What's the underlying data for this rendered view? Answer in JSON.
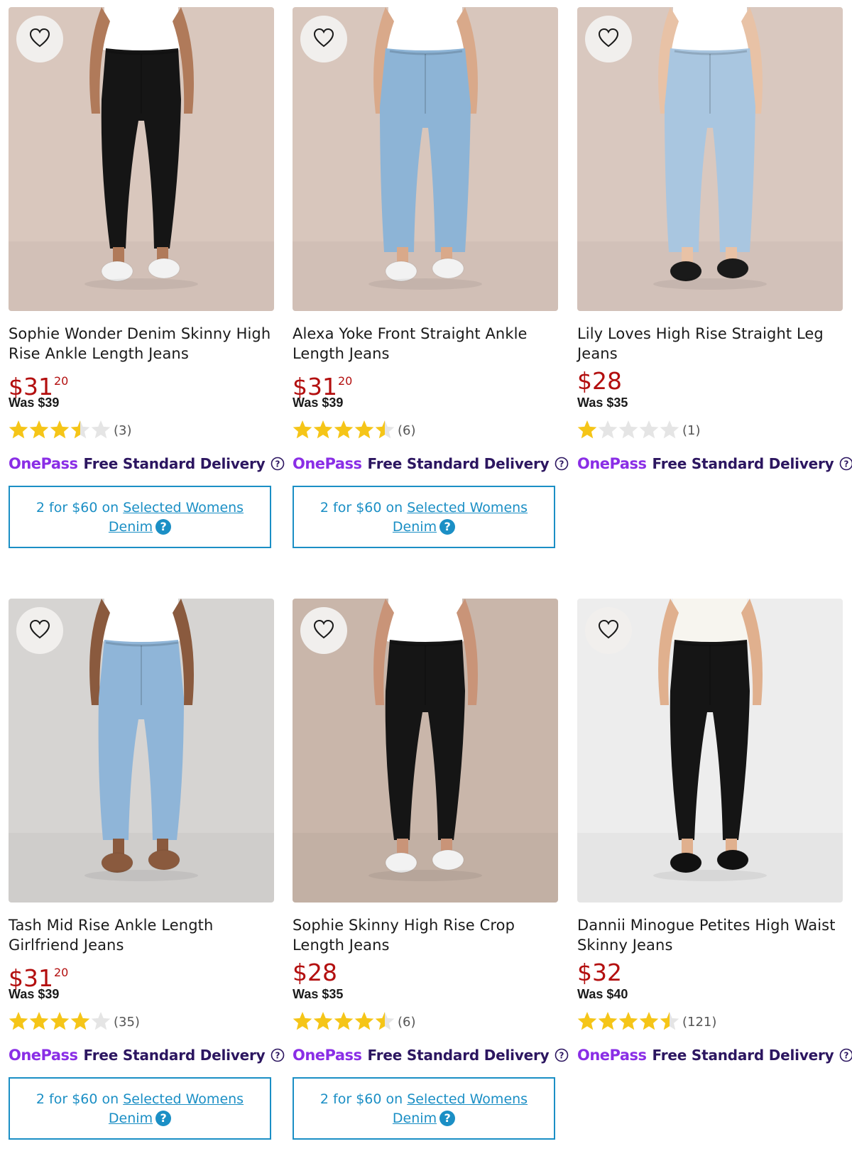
{
  "colors": {
    "price": "#b30f0f",
    "onepass_purple": "#8a2ee6",
    "delivery_text": "#2c1660",
    "promo_blue": "#1b8fc5",
    "star_gold": "#f5c518",
    "star_empty": "#e5e5e5"
  },
  "products": [
    {
      "name": "Sophie Wonder Denim Skinny High Rise Ankle Length Jeans",
      "price_dollars": "$31",
      "price_cents": "20",
      "was": "Was $39",
      "rating": 3.5,
      "reviews": "(3)",
      "onepass": "OnePass",
      "delivery": "Free Standard Delivery",
      "promo": {
        "prefix": "2 for $60 on ",
        "link1": "Selected Womens",
        "link2": "Denim",
        "help": "?"
      },
      "image": {
        "background": "#d9c7bd",
        "jeans": "#151515",
        "shoes": "#f2f2f2",
        "top": "#ffffff",
        "skin": "#b07a5a",
        "style": "skinny"
      },
      "favorite_icon": "heart-outline-icon"
    },
    {
      "name": "Alexa Yoke Front Straight Ankle Length Jeans",
      "price_dollars": "$31",
      "price_cents": "20",
      "was": "Was $39",
      "rating": 4.5,
      "reviews": "(6)",
      "onepass": "OnePass",
      "delivery": "Free Standard Delivery",
      "promo": {
        "prefix": "2 for $60 on ",
        "link1": "Selected Womens",
        "link2": "Denim",
        "help": "?"
      },
      "image": {
        "background": "#d8c6bc",
        "jeans": "#8db4d6",
        "shoes": "#f2f2f2",
        "top": "#ffffff",
        "skin": "#d9a98a",
        "style": "straight"
      },
      "favorite_icon": "heart-outline-icon"
    },
    {
      "name": "Lily Loves High Rise Straight Leg Jeans",
      "price_dollars": "$28",
      "price_cents": "",
      "was": "Was $35",
      "rating": 1,
      "reviews": "(1)",
      "onepass": "OnePass",
      "delivery": "Free Standard Delivery",
      "promo": null,
      "image": {
        "background": "#d9c8bf",
        "jeans": "#a9c6e0",
        "shoes": "#1a1a1a",
        "top": "#ffffff",
        "skin": "#e8c2a6",
        "style": "straight"
      },
      "favorite_icon": "heart-outline-icon"
    },
    {
      "name": "Tash Mid Rise Ankle Length Girlfriend Jeans",
      "price_dollars": "$31",
      "price_cents": "20",
      "was": "Was $39",
      "rating": 4,
      "reviews": "(35)",
      "onepass": "OnePass",
      "delivery": "Free Standard Delivery",
      "promo": {
        "prefix": "2 for $60 on ",
        "link1": "Selected Womens",
        "link2": "Denim",
        "help": "?"
      },
      "image": {
        "background": "#d6d4d2",
        "jeans": "#8fb5d8",
        "shoes": "#8a5a3e",
        "top": "#ffffff",
        "skin": "#8a5a3e",
        "style": "girlfriend"
      },
      "favorite_icon": "heart-outline-icon"
    },
    {
      "name": "Sophie Skinny High Rise Crop Length Jeans",
      "price_dollars": "$28",
      "price_cents": "",
      "was": "Was $35",
      "rating": 4.5,
      "reviews": "(6)",
      "onepass": "OnePass",
      "delivery": "Free Standard Delivery",
      "promo": {
        "prefix": "2 for $60 on ",
        "link1": "Selected Womens",
        "link2": "Denim",
        "help": "?"
      },
      "image": {
        "background": "#c9b6aa",
        "jeans": "#151515",
        "shoes": "#f2f2f2",
        "top": "#ffffff",
        "skin": "#c99478",
        "style": "skinny"
      },
      "favorite_icon": "heart-outline-icon"
    },
    {
      "name": "Dannii Minogue Petites High Waist Skinny Jeans",
      "price_dollars": "$32",
      "price_cents": "",
      "was": "Was $40",
      "rating": 4.5,
      "reviews": "(121)",
      "onepass": "OnePass",
      "delivery": "Free Standard Delivery",
      "promo": null,
      "image": {
        "background": "#ededed",
        "jeans": "#151515",
        "shoes": "#111111",
        "top": "#f7f5ef",
        "skin": "#e0b08e",
        "style": "skinny"
      },
      "favorite_icon": "heart-outline-icon"
    }
  ]
}
